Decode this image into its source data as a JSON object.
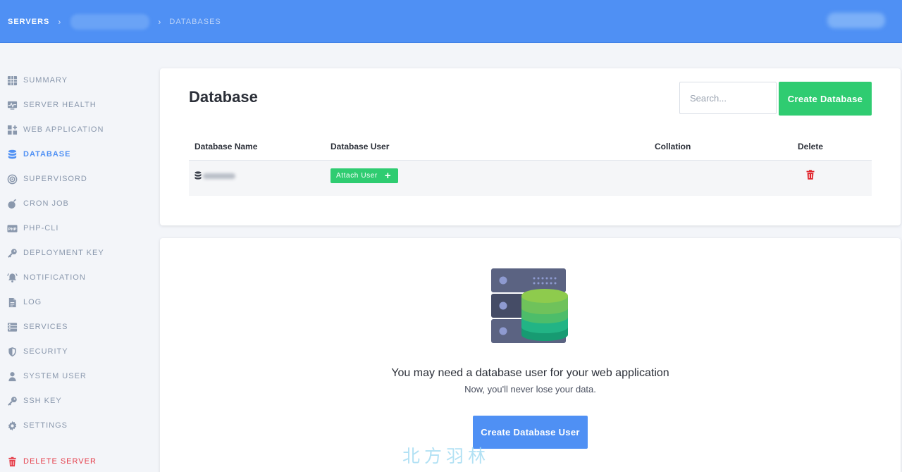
{
  "breadcrumb": {
    "servers": "SERVERS",
    "current": "DATABASES"
  },
  "sidebar": {
    "items": [
      {
        "label": "SUMMARY",
        "icon": "grid-icon"
      },
      {
        "label": "SERVER HEALTH",
        "icon": "pulse-monitor-icon"
      },
      {
        "label": "WEB APPLICATION",
        "icon": "apps-icon"
      },
      {
        "label": "DATABASE",
        "icon": "database-icon",
        "active": true
      },
      {
        "label": "SUPERVISORD",
        "icon": "target-icon"
      },
      {
        "label": "CRON JOB",
        "icon": "bomb-timer-icon"
      },
      {
        "label": "PHP-CLI",
        "icon": "php-icon"
      },
      {
        "label": "DEPLOYMENT KEY",
        "icon": "key-icon"
      },
      {
        "label": "NOTIFICATION",
        "icon": "bell-icon"
      },
      {
        "label": "LOG",
        "icon": "document-icon"
      },
      {
        "label": "SERVICES",
        "icon": "services-icon"
      },
      {
        "label": "SECURITY",
        "icon": "shield-icon"
      },
      {
        "label": "SYSTEM USER",
        "icon": "user-icon"
      },
      {
        "label": "SSH KEY",
        "icon": "key-icon"
      },
      {
        "label": "SETTINGS",
        "icon": "gear-icon"
      }
    ],
    "delete_server": "DELETE SERVER"
  },
  "database_card": {
    "title": "Database",
    "search_placeholder": "Search...",
    "create_button": "Create Database",
    "columns": [
      "Database Name",
      "Database User",
      "Collation",
      "Delete"
    ],
    "row": {
      "attach_user": "Attach User",
      "attach_plus": "+"
    }
  },
  "empty_state": {
    "title": "You may need a database user for your web application",
    "subtitle": "Now, you'll never lose your data.",
    "button": "Create Database User"
  },
  "watermark": "北方羽林",
  "colors": {
    "primary": "#4f90f4",
    "success": "#2fcc71",
    "danger": "#e53e4a",
    "muted": "#8a98ad"
  }
}
